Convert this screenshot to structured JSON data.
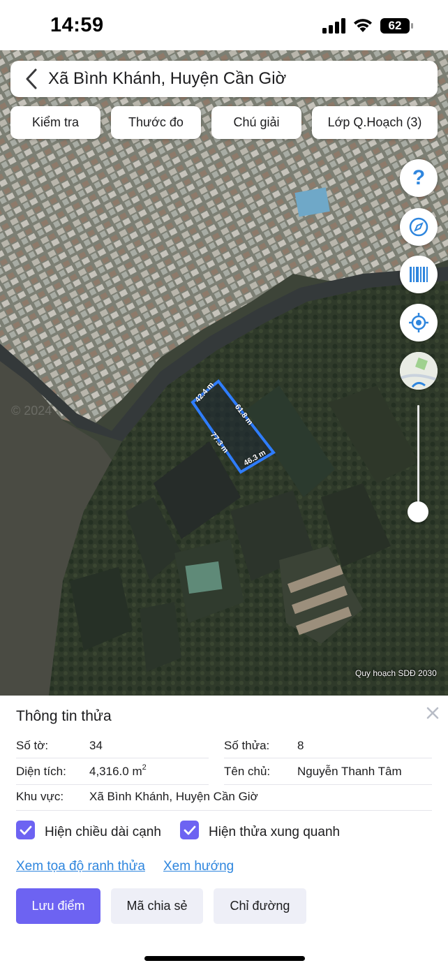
{
  "status_bar": {
    "time": "14:59",
    "battery_level": "62"
  },
  "map": {
    "credit": "Quy hoạch SDĐ 2030",
    "watermark": "© 2024",
    "parcel_edges": [
      "42.4 m",
      "61.8 m",
      "77.3 m",
      "46.3 m"
    ]
  },
  "header": {
    "title": "Xã Bình Khánh, Huyện Cần Giờ"
  },
  "toolbar": {
    "buttons": [
      "Kiểm tra",
      "Thước đo",
      "Chú giải",
      "Lớp Q.Hoạch (3)"
    ]
  },
  "map_controls": {
    "help_symbol": "?",
    "items": [
      "help-icon",
      "compass-icon",
      "barcode-icon",
      "locate-icon",
      "map-type-icon"
    ],
    "zoom_level": 1.0
  },
  "parcel_info": {
    "title": "Thông tin thửa",
    "sheet_label": "Số tờ:",
    "sheet_value": "34",
    "parcel_label": "Số thửa:",
    "parcel_value": "8",
    "area_label": "Diện tích:",
    "area_value": "4,316.0 m",
    "area_unit_sup": "2",
    "owner_label": "Tên chủ:",
    "owner_value": "Nguyễn Thanh Tâm",
    "region_label": "Khu vực:",
    "region_value": "Xã Bình Khánh, Huyện Cần Giờ"
  },
  "options": {
    "show_edge_length": "Hiện chiều dài cạnh",
    "show_edge_length_checked": true,
    "show_neighbors": "Hiện thửa xung quanh",
    "show_neighbors_checked": true
  },
  "links": {
    "view_coordinates": "Xem tọa độ ranh thửa",
    "view_direction": "Xem hướng"
  },
  "actions": {
    "save_point": "Lưu điểm",
    "share_code": "Mã chia sẻ",
    "directions": "Chỉ đường"
  },
  "colors": {
    "accent": "#6d63f2",
    "link": "#2f86de",
    "parcel_outline": "#2f7dff",
    "control_icon": "#2f86de"
  }
}
